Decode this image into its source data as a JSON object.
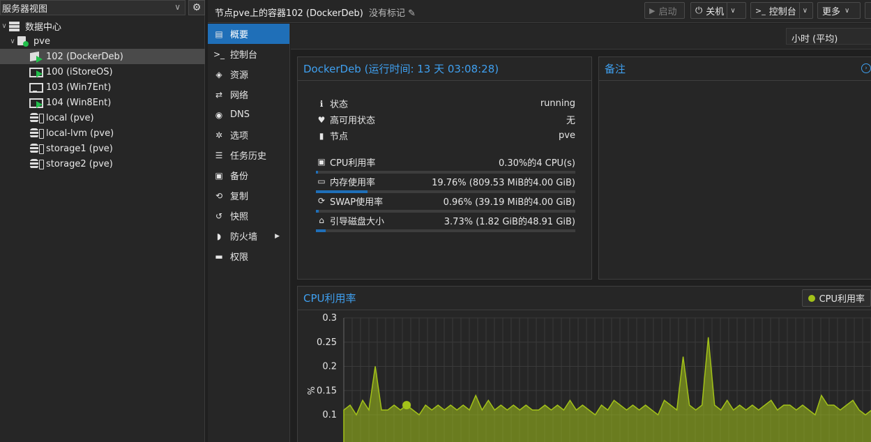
{
  "tree": {
    "view_label": "服务器视图",
    "items": [
      {
        "label": "数据中心",
        "level": 0,
        "type": "datacenter",
        "toggle": "∨"
      },
      {
        "label": "pve",
        "level": 1,
        "type": "node",
        "toggle": "∨"
      },
      {
        "label": "102 (DockerDeb)",
        "level": 2,
        "type": "ct-running",
        "selected": true
      },
      {
        "label": "100 (iStoreOS)",
        "level": 2,
        "type": "vm-running"
      },
      {
        "label": "103 (Win7Ent)",
        "level": 2,
        "type": "vm-stopped"
      },
      {
        "label": "104 (Win8Ent)",
        "level": 2,
        "type": "vm-running"
      },
      {
        "label": "local (pve)",
        "level": 2,
        "type": "storage"
      },
      {
        "label": "local-lvm (pve)",
        "level": 2,
        "type": "storage"
      },
      {
        "label": "storage1 (pve)",
        "level": 2,
        "type": "storage"
      },
      {
        "label": "storage2 (pve)",
        "level": 2,
        "type": "storage"
      }
    ]
  },
  "header": {
    "title": "节点pve上的容器102 (DockerDeb)",
    "tags": "没有标记",
    "buttons": {
      "start": "启动",
      "shutdown": "关机",
      "console": "控制台",
      "more": "更多"
    }
  },
  "nav": {
    "items": [
      {
        "label": "概要",
        "icon": "book-icon",
        "glyph": "▤",
        "active": true
      },
      {
        "label": "控制台",
        "icon": "terminal-icon",
        "glyph": ">_"
      },
      {
        "label": "资源",
        "icon": "cube-icon",
        "glyph": "◈"
      },
      {
        "label": "网络",
        "icon": "exchange-icon",
        "glyph": "⇄"
      },
      {
        "label": "DNS",
        "icon": "globe-icon",
        "glyph": "◉"
      },
      {
        "label": "选项",
        "icon": "gear-icon",
        "glyph": "✲"
      },
      {
        "label": "任务历史",
        "icon": "list-icon",
        "glyph": "☰"
      },
      {
        "label": "备份",
        "icon": "floppy-icon",
        "glyph": "▣"
      },
      {
        "label": "复制",
        "icon": "retweet-icon",
        "glyph": "⟲"
      },
      {
        "label": "快照",
        "icon": "history-icon",
        "glyph": "↺"
      },
      {
        "label": "防火墙",
        "icon": "shield-icon",
        "glyph": "◗",
        "submenu": true
      },
      {
        "label": "权限",
        "icon": "unlock-icon",
        "glyph": "▬"
      }
    ]
  },
  "timeframe": "小时 (平均)",
  "status_panel": {
    "title": "DockerDeb (运行时间: 13 天 03:08:28)",
    "rows": [
      {
        "icon": "info-icon",
        "glyph": "ℹ",
        "label": "状态",
        "value": "running"
      },
      {
        "icon": "heartbeat-icon",
        "glyph": "♥",
        "label": "高可用状态",
        "value": "无"
      },
      {
        "icon": "server-icon",
        "glyph": "▮",
        "label": "节点",
        "value": "pve"
      }
    ],
    "metrics": [
      {
        "icon": "cpu-icon",
        "glyph": "▣",
        "label": "CPU利用率",
        "value": "0.30%的4 CPU(s)",
        "fraction": 0.003
      },
      {
        "icon": "memory-icon",
        "glyph": "▭",
        "label": "内存使用率",
        "value": "19.76% (809.53 MiB的4.00 GiB)",
        "fraction": 0.1976
      },
      {
        "icon": "refresh-icon",
        "glyph": "⟳",
        "label": "SWAP使用率",
        "value": "0.96% (39.19 MiB的4.00 GiB)",
        "fraction": 0.0096
      },
      {
        "icon": "hdd-icon",
        "glyph": "⌂",
        "label": "引导磁盘大小",
        "value": "3.73% (1.82 GiB的48.91 GiB)",
        "fraction": 0.0373
      }
    ]
  },
  "notes_panel": {
    "title": "备注"
  },
  "chart_data": {
    "type": "area",
    "title": "CPU利用率",
    "ylabel": "%",
    "ylim": [
      0.08,
      0.3
    ],
    "yticks": [
      0.3,
      0.25,
      0.2,
      0.15,
      0.1
    ],
    "ytick_labels": [
      "0.3",
      "0.25",
      "0.2",
      "0.15",
      "0.1"
    ],
    "grid": true,
    "color": "#a3c219",
    "series": [
      {
        "name": "CPU利用率",
        "values": [
          0.11,
          0.12,
          0.1,
          0.13,
          0.11,
          0.2,
          0.11,
          0.11,
          0.12,
          0.11,
          0.12,
          0.11,
          0.1,
          0.12,
          0.11,
          0.12,
          0.11,
          0.12,
          0.11,
          0.12,
          0.11,
          0.14,
          0.11,
          0.13,
          0.11,
          0.12,
          0.11,
          0.12,
          0.11,
          0.12,
          0.11,
          0.11,
          0.12,
          0.11,
          0.12,
          0.11,
          0.13,
          0.11,
          0.12,
          0.11,
          0.1,
          0.12,
          0.11,
          0.13,
          0.12,
          0.11,
          0.12,
          0.11,
          0.12,
          0.11,
          0.1,
          0.13,
          0.12,
          0.11,
          0.22,
          0.12,
          0.11,
          0.12,
          0.26,
          0.12,
          0.11,
          0.13,
          0.11,
          0.12,
          0.11,
          0.12,
          0.11,
          0.12,
          0.13,
          0.11,
          0.12,
          0.12,
          0.11,
          0.12,
          0.11,
          0.1,
          0.14,
          0.12,
          0.12,
          0.11,
          0.12,
          0.13,
          0.11,
          0.1,
          0.11,
          0.12
        ]
      }
    ],
    "highlight_index": 10,
    "legend": "top-right"
  }
}
